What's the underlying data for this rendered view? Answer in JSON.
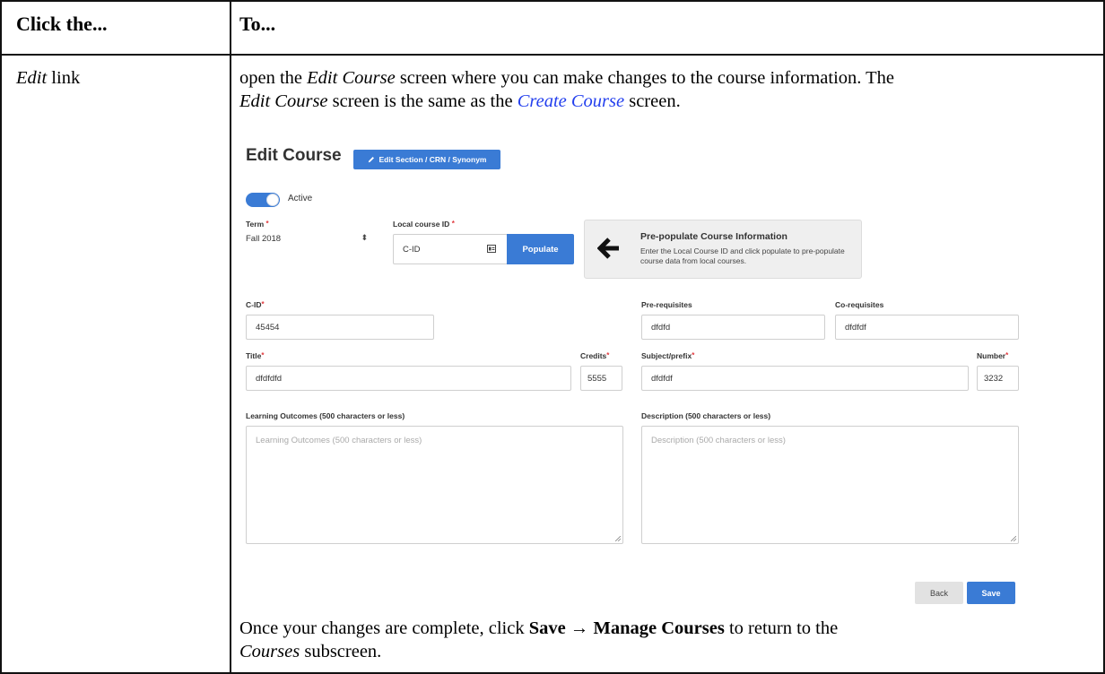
{
  "table": {
    "header_col1": "Click the...",
    "header_col2": "To...",
    "row1_col1": "Edit",
    "row1_col1_suffix": " link",
    "intro_part1": "open the ",
    "intro_edit_course": "Edit Course",
    "intro_part2": " screen where you can make changes to the course information. The",
    "intro_edit_course2": "Edit Course",
    "intro_part3": " screen is the same as the ",
    "intro_link": "Create Course",
    "intro_part4": " screen.",
    "outro_part1": "Once your changes are complete, click ",
    "outro_bold": "Save → Manage Courses",
    "outro_part2": " to return to the",
    "outro_courses": "Courses",
    "outro_part3": " subscreen."
  },
  "screenshot": {
    "title": "Edit Course",
    "edit_section_button": "Edit Section / CRN / Synonym",
    "active_label": "Active",
    "term_label": "Term",
    "term_value": "Fall 2018",
    "local_course_label": "Local course ID",
    "local_course_value": "C-ID",
    "populate_button": "Populate",
    "prepop_title": "Pre-populate Course Information",
    "prepop_desc": "Enter the Local Course ID and click populate to pre-populate course data from local courses.",
    "cid_label": "C-ID",
    "cid_value": "45454",
    "prereq_label": "Pre-requisites",
    "prereq_value": "dfdfd",
    "coreq_label": "Co-requisites",
    "coreq_value": "dfdfdf",
    "title_label": "Title",
    "title_value": "dfdfdfd",
    "credits_label": "Credits",
    "credits_value": "5555",
    "subject_label": "Subject/prefix",
    "subject_value": "dfdfdf",
    "number_label": "Number",
    "number_value": "3232",
    "outcomes_label": "Learning Outcomes (500 characters or less)",
    "outcomes_placeholder": "Learning Outcomes (500 characters or less)",
    "description_label": "Description (500 characters or less)",
    "description_placeholder": "Description (500 characters or less)",
    "back_button": "Back",
    "save_button": "Save",
    "required_mark": "*"
  },
  "colors": {
    "primary": "#3a7bd5",
    "required": "#e0393e",
    "link": "#2440ee"
  }
}
